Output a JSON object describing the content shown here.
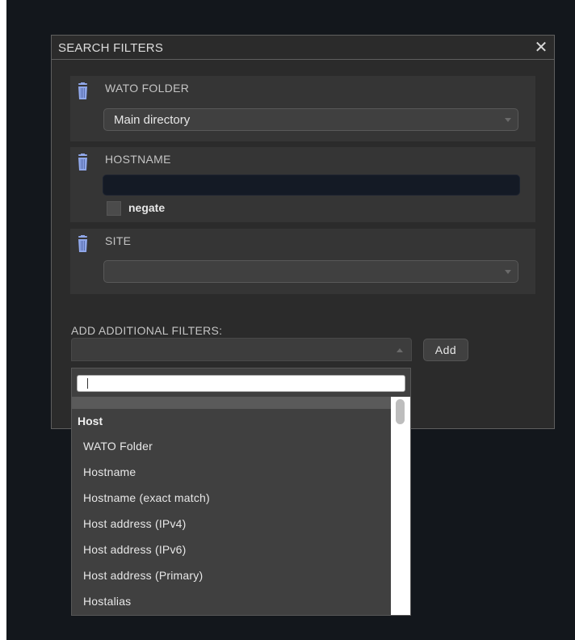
{
  "dialog": {
    "title": "SEARCH FILTERS",
    "close_symbol": "✕"
  },
  "filters": [
    {
      "label": "WATO FOLDER",
      "type": "select",
      "value": "Main directory",
      "icon": "trash-icon"
    },
    {
      "label": "HOSTNAME",
      "type": "text",
      "value": "",
      "negate_label": "negate",
      "negate_checked": false,
      "icon": "trash-icon"
    },
    {
      "label": "SITE",
      "type": "select",
      "value": "",
      "icon": "trash-icon"
    }
  ],
  "add_filters": {
    "label": "ADD ADDITIONAL FILTERS:",
    "selected": "",
    "button_label": "Add"
  },
  "dropdown": {
    "search_value": "",
    "group": "Host",
    "options": [
      "WATO Folder",
      "Hostname",
      "Hostname (exact match)",
      "Host address (IPv4)",
      "Host address (IPv6)",
      "Host address (Primary)",
      "Hostalias"
    ]
  },
  "colors": {
    "backdrop": "#13171c",
    "panel": "#2b2b2b",
    "filter_block": "#353535",
    "trash_icon": "#8fa6e8",
    "text_input_bg": "#141a25"
  }
}
